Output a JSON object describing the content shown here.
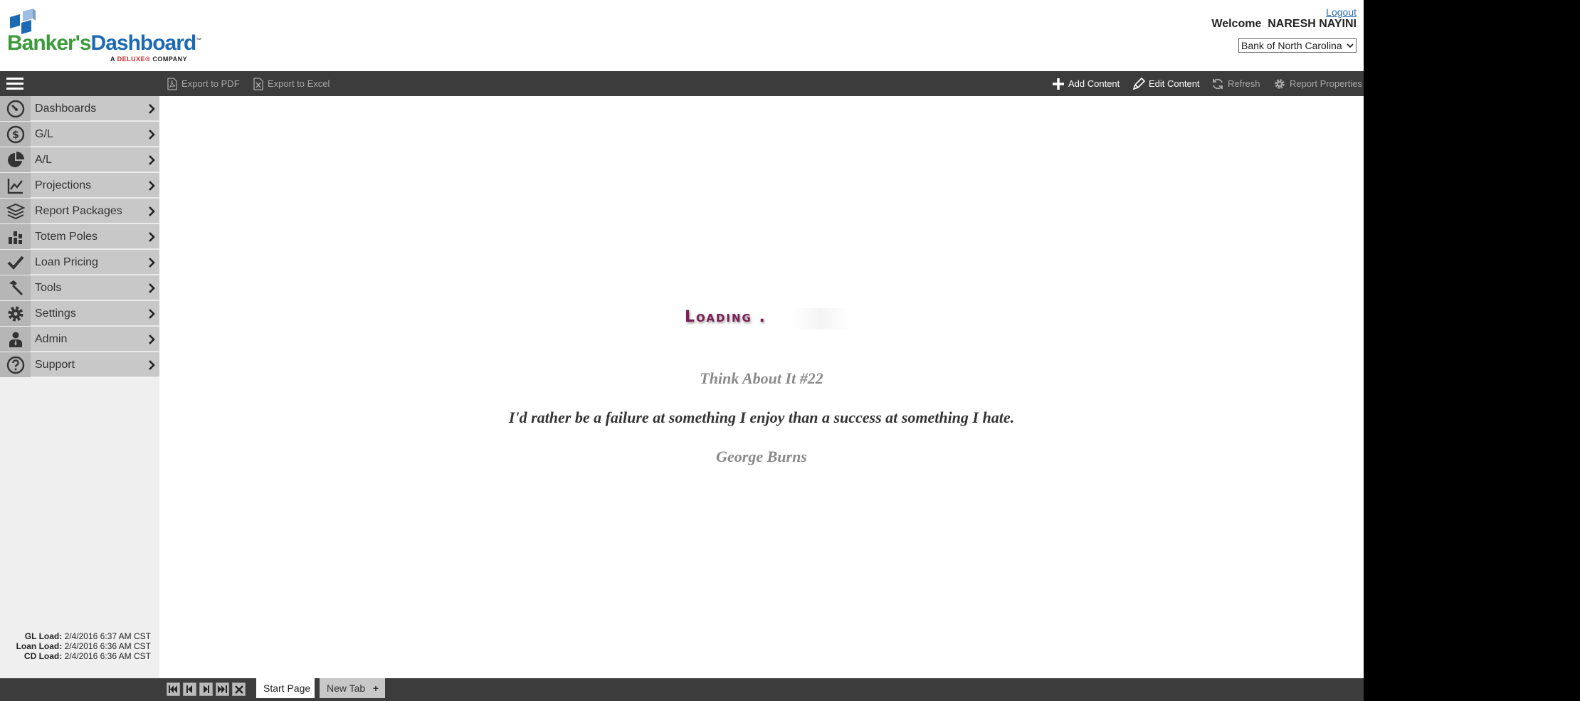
{
  "header": {
    "logo": {
      "word1": "Banker's",
      "word2": "Dashboard",
      "tm": "™",
      "tagline_prefix": "A ",
      "tagline_brand": "DELUXE",
      "tagline_mark": "®",
      "tagline_suffix": " COMPANY"
    },
    "logout_label": "Logout",
    "welcome_text": "Welcome  NARESH NAYINI",
    "bank_selected": "Bank of North Carolina"
  },
  "toolbar": {
    "export_pdf": "Export to PDF",
    "export_excel": "Export to Excel",
    "add_content": "Add Content",
    "edit_content": "Edit Content",
    "refresh": "Refresh",
    "report_properties": "Report Properties"
  },
  "sidebar": {
    "items": [
      {
        "label": "Dashboards",
        "icon": "gauge-icon"
      },
      {
        "label": "G/L",
        "icon": "dollar-icon"
      },
      {
        "label": "A/L",
        "icon": "pie-icon"
      },
      {
        "label": "Projections",
        "icon": "line-chart-icon"
      },
      {
        "label": "Report Packages",
        "icon": "layers-icon"
      },
      {
        "label": "Totem Poles",
        "icon": "bars-icon"
      },
      {
        "label": "Loan Pricing",
        "icon": "check-icon"
      },
      {
        "label": "Tools",
        "icon": "hammer-icon"
      },
      {
        "label": "Settings",
        "icon": "gear-icon"
      },
      {
        "label": "Admin",
        "icon": "person-icon"
      },
      {
        "label": "Support",
        "icon": "question-icon"
      }
    ],
    "load_info": [
      {
        "label": "GL Load:",
        "value": "2/4/2016 6:37 AM CST"
      },
      {
        "label": "Loan Load:",
        "value": "2/4/2016 6:36 AM CST"
      },
      {
        "label": "CD Load:",
        "value": "2/4/2016 6:36 AM CST"
      }
    ]
  },
  "main": {
    "loading_text": "Loading .",
    "quote_title": "Think About It #22",
    "quote_text": "I'd rather be a failure at something I enjoy than a success at something I hate.",
    "quote_author": "George Burns"
  },
  "tabs": {
    "start_page": "Start Page",
    "new_tab": "New Tab",
    "new_tab_plus": "+"
  },
  "colors": {
    "toolbar_bg": "#3c3c3c",
    "sidebar_item_bg": "#c8c8c8",
    "brand_green": "#3d9a3a",
    "brand_blue": "#1d6ab4",
    "loading_color": "#7a1f55"
  }
}
